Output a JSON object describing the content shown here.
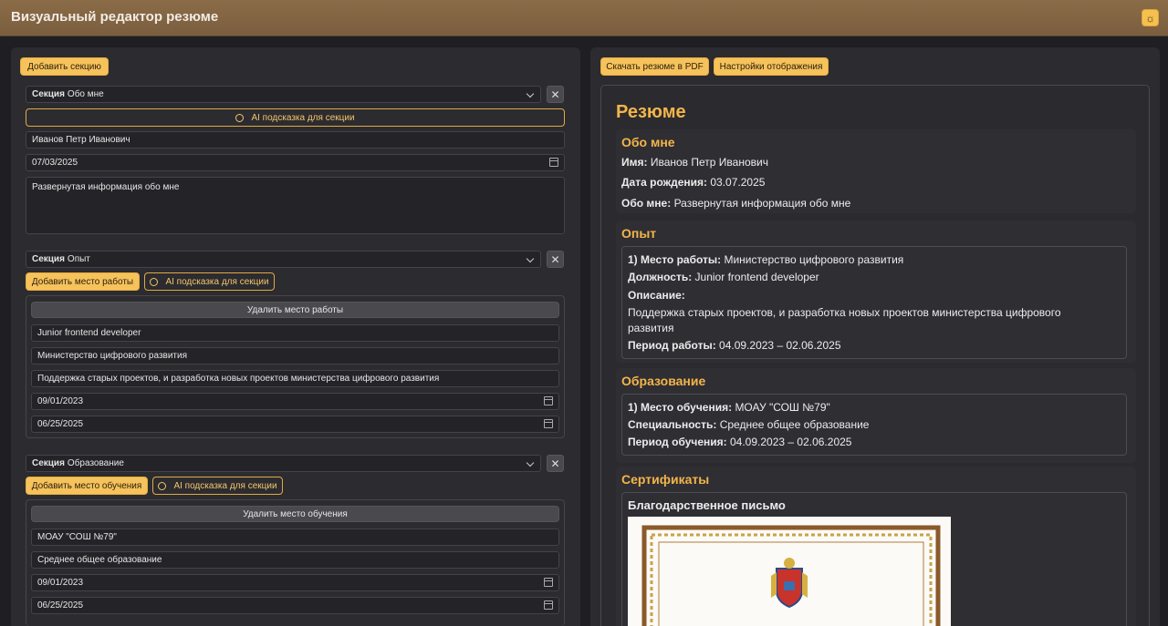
{
  "app": {
    "title": "Визуальный редактор резюме",
    "theme_icon": "sun-icon"
  },
  "editor": {
    "add_section_label": "Добавить секцию",
    "section_prefix": "Секция",
    "ai_hint_label": "AI подсказка для секции",
    "about": {
      "section_name": "Обо мне",
      "name_value": "Иванов Петр Иванович",
      "birth_date_value": "07/03/2025",
      "about_value": "Развернутая информация обо мне"
    },
    "experience": {
      "section_name": "Опыт",
      "add_label": "Добавить место работы",
      "remove_label": "Удалить место работы",
      "position_value": "Junior frontend developer",
      "company_value": "Министерство цифрового развития",
      "description_value": "Поддержка старых проектов, и разработка новых проектов министерства цифрового развития",
      "start_value": "09/01/2023",
      "end_value": "06/25/2025"
    },
    "education": {
      "section_name": "Образование",
      "add_label": "Добавить место обучения",
      "remove_label": "Удалить место обучения",
      "institution_value": "МОАУ \"СОШ №79\"",
      "specialty_value": "Среднее общее образование",
      "start_value": "09/01/2023",
      "end_value": "06/25/2025"
    }
  },
  "preview": {
    "download_label": "Скачать резюме в PDF",
    "settings_label": "Настройки отображения",
    "title": "Резюме",
    "about": {
      "heading": "Обо мне",
      "name_key": "Имя:",
      "name_val": "Иванов Петр Иванович",
      "birth_key": "Дата рождения:",
      "birth_val": "03.07.2025",
      "about_key": "Обо мне:",
      "about_val": "Развернутая информация обо мне"
    },
    "experience": {
      "heading": "Опыт",
      "place_key": "1) Место работы:",
      "place_val": "Министерство цифрового развития",
      "position_key": "Должность:",
      "position_val": "Junior frontend developer",
      "desc_key": "Описание:",
      "desc_line1": "Поддержка старых проектов, и разработка новых проектов министерства цифрового",
      "desc_line2": "развития",
      "period_key": "Период работы:",
      "period_val": "04.09.2023 – 02.06.2025"
    },
    "education": {
      "heading": "Образование",
      "place_key": "1) Место обучения:",
      "place_val": "МОАУ \"СОШ №79\"",
      "spec_key": "Специальность:",
      "spec_val": "Среднее общее образование",
      "period_key": "Период обучения:",
      "period_val": "04.09.2023 – 02.06.2025"
    },
    "certificates": {
      "heading": "Сертификаты",
      "item_title": "Благодарственное письмо"
    }
  }
}
